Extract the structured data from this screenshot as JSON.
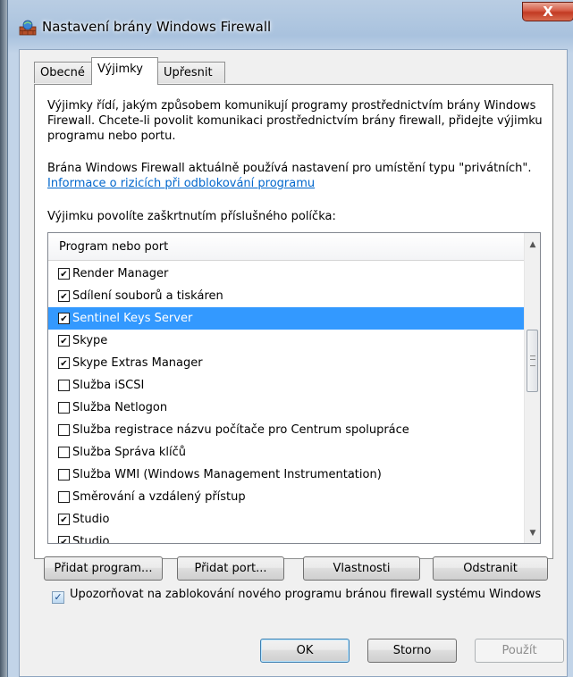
{
  "window": {
    "title": "Nastavení brány Windows Firewall",
    "close_glyph": "X"
  },
  "tabs": [
    {
      "label": "Obecné",
      "active": false
    },
    {
      "label": "Výjimky",
      "active": true
    },
    {
      "label": "Upřesnit",
      "active": false
    }
  ],
  "exceptions": {
    "intro": "Výjimky řídí, jakým způsobem komunikují programy prostřednictvím brány Windows Firewall. Chcete-li povolit komunikaci prostřednictvím brány firewall, přidejte výjimku programu nebo portu.",
    "location_text": "Brána Windows Firewall aktuálně používá nastavení pro umístění typu \"privátních\".",
    "location_link": "Informace o rizicích při odblokování programu",
    "instruction": "Výjimku povolíte zaškrtnutím příslušného políčka:",
    "list_header": "Program nebo port",
    "items": [
      {
        "label": "Render Manager",
        "checked": true
      },
      {
        "label": "Sdílení souborů a tiskáren",
        "checked": true
      },
      {
        "label": "Sentinel Keys Server",
        "checked": true,
        "selected": true
      },
      {
        "label": "Skype",
        "checked": true
      },
      {
        "label": "Skype Extras Manager",
        "checked": true
      },
      {
        "label": "Služba iSCSI",
        "checked": false
      },
      {
        "label": "Služba Netlogon",
        "checked": false
      },
      {
        "label": "Služba registrace názvu počítače pro Centrum spolupráce",
        "checked": false
      },
      {
        "label": "Služba Správa klíčů",
        "checked": false
      },
      {
        "label": "Služba WMI (Windows Management Instrumentation)",
        "checked": false
      },
      {
        "label": "Směrování a vzdálený přístup",
        "checked": false
      },
      {
        "label": "Studio",
        "checked": true
      },
      {
        "label": "Studio",
        "checked": true
      }
    ]
  },
  "buttons": {
    "add_program": "Přidat program...",
    "add_port": "Přidat port...",
    "properties": "Vlastnosti",
    "remove": "Odstranit",
    "ok": "OK",
    "cancel": "Storno",
    "apply": "Použít"
  },
  "notify": {
    "label": "Upozorňovat na zablokování nového programu bránou firewall systému Windows",
    "checked": true
  }
}
